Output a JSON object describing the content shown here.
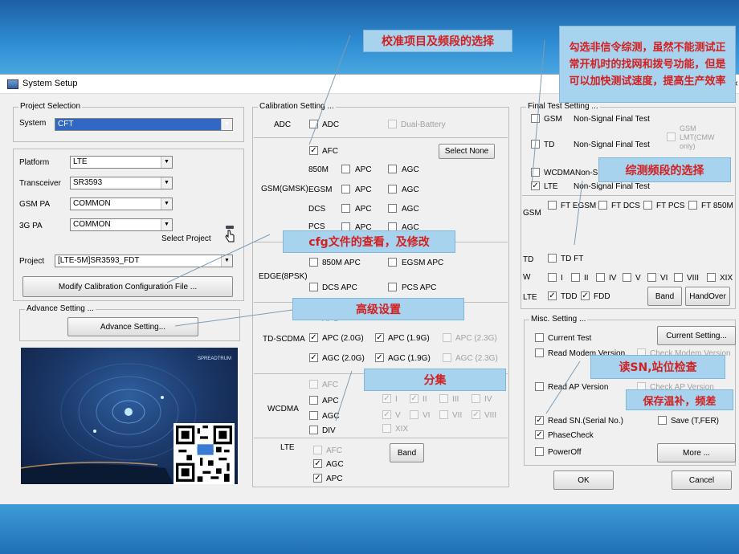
{
  "window": {
    "title": "System Setup",
    "close": "×"
  },
  "project_selection": {
    "label": "Project Selection",
    "system_label": "System",
    "system_value": "CFT",
    "platform_label": "Platform",
    "platform_value": "LTE",
    "transceiver_label": "Transceiver",
    "transceiver_value": "SR3593",
    "gsm_pa_label": "GSM PA",
    "gsm_pa_value": "COMMON",
    "pa3g_label": "3G PA",
    "pa3g_value": "COMMON",
    "select_project": "Select Project",
    "project_label": "Project",
    "project_value": "[LTE-5M]SR3593_FDT",
    "modify_button": "Modify Calibration Configuration File ..."
  },
  "advance": {
    "label": "Advance Setting ...",
    "button": "Advance Setting..."
  },
  "calibration": {
    "label": "Calibration Setting ...",
    "adc_row": "ADC",
    "adc": "ADC",
    "dual_battery": "Dual-Battery",
    "afc": "AFC",
    "select_none": "Select None",
    "gsm_label": "GSM(GMSK)",
    "band_850": "850M",
    "band_egsm": "EGSM",
    "band_dcs": "DCS",
    "band_pcs": "PCS",
    "apc": "APC",
    "agc": "AGC",
    "edge_label": "EDGE(8PSK)",
    "edge_850": "850M APC",
    "edge_egsm": "EGSM APC",
    "edge_dcs": "DCS APC",
    "edge_pcs": "PCS APC",
    "td_label": "TD-SCDMA",
    "td_apc": "APC",
    "td_apc20": "APC (2.0G)",
    "td_apc19": "APC (1.9G)",
    "td_apc23": "APC (2.3G)",
    "td_agc20": "AGC (2.0G)",
    "td_agc19": "AGC (1.9G)",
    "td_agc23": "AGC (2.3G)",
    "wcdma_label": "WCDMA",
    "w_afc": "AFC",
    "w_apc": "APC",
    "w_agc": "AGC",
    "w_div": "DIV",
    "w_bands": [
      "I",
      "II",
      "III",
      "IV",
      "V",
      "VI",
      "VII",
      "VIII",
      "XIX"
    ],
    "lte_label": "LTE",
    "lte_afc": "AFC",
    "lte_agc": "AGC",
    "lte_apc": "APC",
    "band_button": "Band"
  },
  "final_test": {
    "label": "Final Test Setting ...",
    "gsm": "GSM",
    "td": "TD",
    "wcdma": "WCDMA",
    "lte": "LTE",
    "nsft": "Non-Signal Final Test",
    "gsm_lmt": "GSM LMT(CMW only)",
    "wcdma_nsft_partial": "Non-S",
    "gsm_row": "GSM",
    "ft_egsm": "FT EGSM",
    "ft_dcs": "FT DCS",
    "ft_pcs": "FT PCS",
    "ft_850": "FT 850M",
    "td_row": "TD",
    "td_ft": "TD FT",
    "w_row": "W",
    "w_bands": [
      "I",
      "II",
      "IV",
      "V",
      "VI",
      "VIII",
      "XIX"
    ],
    "lte_row": "LTE",
    "tdd": "TDD",
    "fdd": "FDD",
    "band_button": "Band",
    "handover_button": "HandOver"
  },
  "misc": {
    "label": "Misc. Setting ...",
    "current_test": "Current Test",
    "current_setting": "Current Setting...",
    "read_modem": "Read Modem Version",
    "check_modem": "Check Modem Version",
    "read_ap": "Read AP Version",
    "check_ap": "Check AP Version",
    "read_sn": "Read SN.(Serial No.)",
    "save": "Save (T,FER)",
    "phasecheck": "PhaseCheck",
    "poweroff": "PowerOff",
    "more": "More ..."
  },
  "buttons": {
    "ok": "OK",
    "cancel": "Cancel"
  },
  "splash": {
    "brand": "SPREADTRUM"
  },
  "callouts": {
    "c1": "校准项目及频段的选择",
    "c2": "勾选非信令综测，虽然不能测试正常开机时的找网和拨号功能，但是可以加快测试速度，提高生产效率",
    "c3": "综测频段的选择",
    "c4": "cfg文件的查看，及修改",
    "c5": "高级设置",
    "c6": "分集",
    "c7": "读SN,站位检查",
    "c8": "保存温补，频差"
  }
}
